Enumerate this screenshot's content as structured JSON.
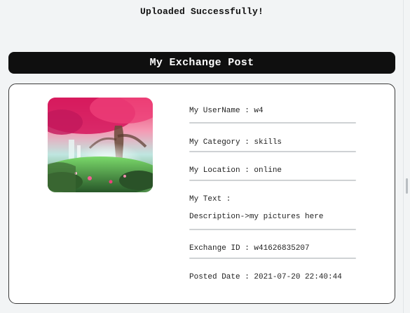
{
  "status": {
    "message": "Uploaded Successfully!"
  },
  "section": {
    "title": "My Exchange Post"
  },
  "post": {
    "image_alt": "fantasy forest waterfall with pink blossom tree",
    "username_label": "My UserName : w4",
    "category_label": "My Category : skills",
    "location_label": "My Location : online",
    "text_label": "My Text :",
    "description": "Description->my pictures here",
    "exchange_id_label": "Exchange ID : w41626835207",
    "posted_date_label": "Posted Date : 2021-07-20 22:40:44"
  },
  "colors": {
    "header_bg": "#0f0f0f",
    "header_text": "#ffffff",
    "page_bg": "#f2f4f5",
    "card_border": "#3a3a3a",
    "divider": "#cfd2d4"
  }
}
